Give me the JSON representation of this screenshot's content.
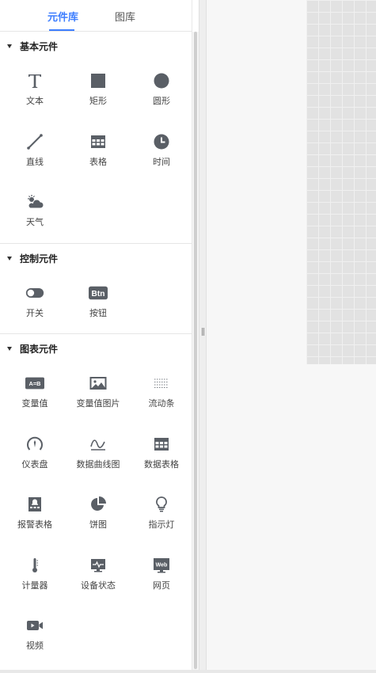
{
  "tabs": [
    {
      "label": "元件库",
      "active": true
    },
    {
      "label": "图库",
      "active": false
    }
  ],
  "accent_color": "#3d7eff",
  "icon_color": "#5a5f66",
  "sections": [
    {
      "title": "基本元件",
      "items": [
        {
          "label": "文本",
          "icon": "text-icon"
        },
        {
          "label": "矩形",
          "icon": "rectangle-icon"
        },
        {
          "label": "圆形",
          "icon": "circle-icon"
        },
        {
          "label": "直线",
          "icon": "line-icon"
        },
        {
          "label": "表格",
          "icon": "table-icon"
        },
        {
          "label": "时间",
          "icon": "clock-icon"
        },
        {
          "label": "天气",
          "icon": "weather-icon"
        }
      ]
    },
    {
      "title": "控制元件",
      "items": [
        {
          "label": "开关",
          "icon": "toggle-switch-icon"
        },
        {
          "label": "按钮",
          "icon": "button-icon",
          "icon_text": "Btn"
        }
      ]
    },
    {
      "title": "图表元件",
      "items": [
        {
          "label": "变量值",
          "icon": "variable-value-icon",
          "icon_text": "A=B"
        },
        {
          "label": "变量值图片",
          "icon": "variable-image-icon"
        },
        {
          "label": "流动条",
          "icon": "flow-bar-icon"
        },
        {
          "label": "仪表盘",
          "icon": "gauge-icon"
        },
        {
          "label": "数据曲线图",
          "icon": "curve-chart-icon"
        },
        {
          "label": "数据表格",
          "icon": "data-table-icon"
        },
        {
          "label": "报警表格",
          "icon": "alarm-table-icon"
        },
        {
          "label": "饼图",
          "icon": "pie-chart-icon"
        },
        {
          "label": "指示灯",
          "icon": "indicator-bulb-icon"
        },
        {
          "label": "计量器",
          "icon": "thermometer-icon"
        },
        {
          "label": "设备状态",
          "icon": "device-status-icon"
        },
        {
          "label": "网页",
          "icon": "webpage-icon",
          "icon_text": "Web"
        },
        {
          "label": "视频",
          "icon": "video-icon"
        }
      ]
    }
  ]
}
